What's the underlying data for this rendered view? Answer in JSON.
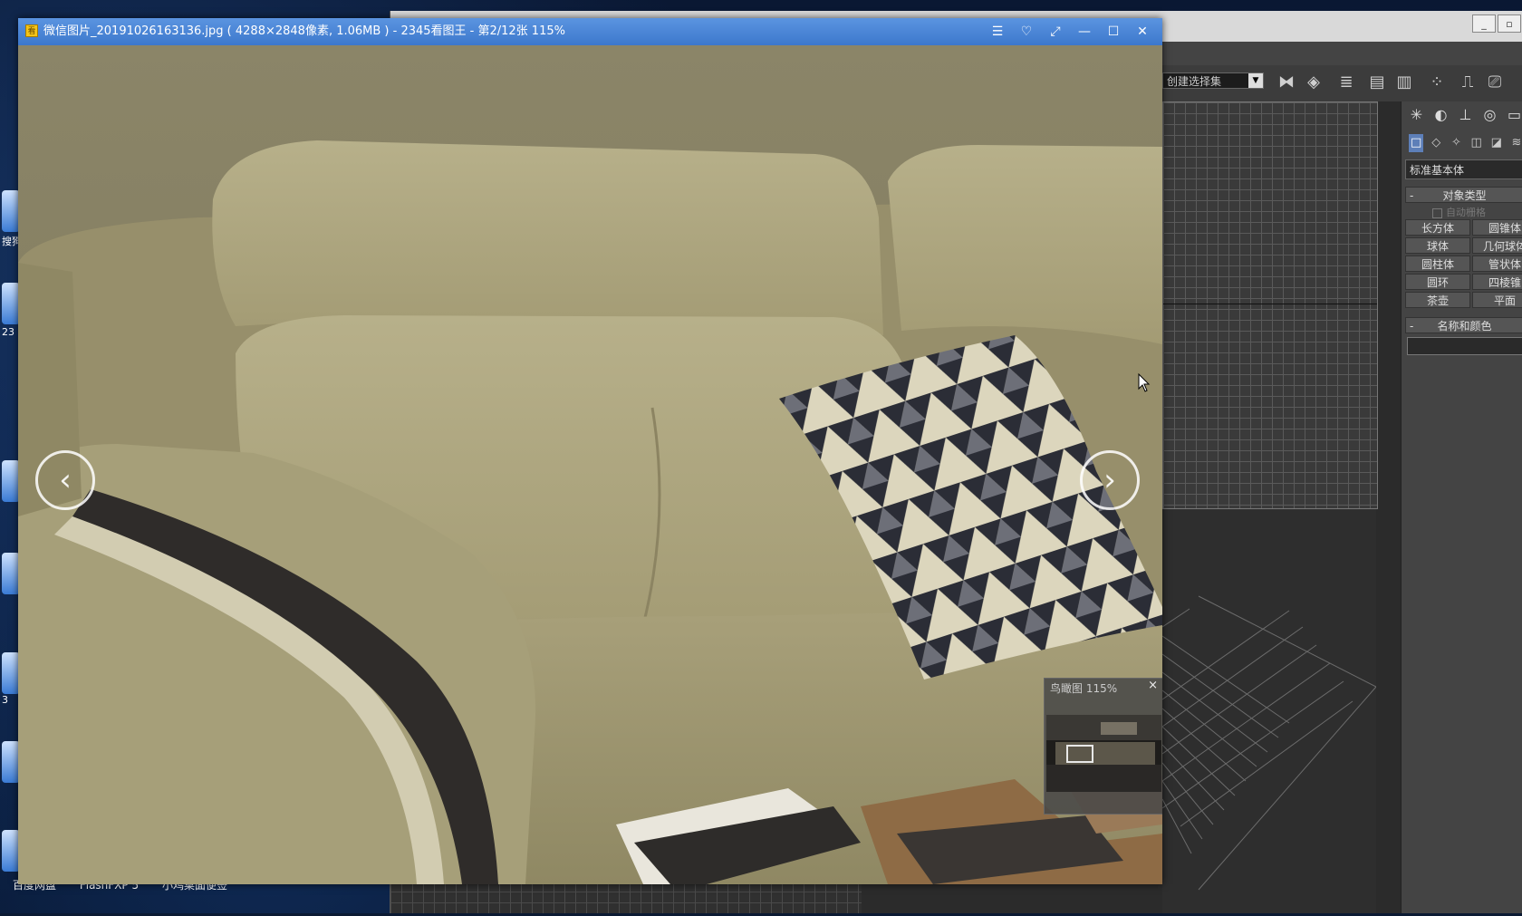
{
  "desktop": {
    "labels": [
      "搜狗",
      "23",
      "3",
      "百度网盘",
      "FlashFXP 5",
      "小鸡桌面便签"
    ]
  },
  "max_app": {
    "named_selection_placeholder": "创建选择集",
    "command_panel": {
      "category": "标准基本体",
      "object_type_title": "对象类型",
      "autogrid_label": "自动栅格",
      "buttons": [
        "长方体",
        "圆锥体",
        "球体",
        "几何球体",
        "圆柱体",
        "管状体",
        "圆环",
        "四棱锥",
        "茶壶",
        "平面"
      ],
      "name_color_title": "名称和颜色",
      "collapse_symbol": "-"
    }
  },
  "viewer": {
    "title": "微信图片_20191026163136.jpg ( 4288×2848像素, 1.06MB ) - 2345看图王 - 第2/12张 115%",
    "controls": {
      "menu": "☰",
      "skin": "♡",
      "fullscreen": "⤢",
      "minimize": "—",
      "maximize": "☐",
      "close": "✕"
    },
    "prev_symbol": "‹",
    "next_symbol": "›",
    "navigator": {
      "title": "鸟瞰图 115%",
      "close": "×"
    }
  },
  "colors": {
    "viewer_title_bg": "#4a86d8",
    "sofa": "#a9a27c",
    "pillow_dark": "#2b2d36",
    "pillow_light": "#dcd6bd"
  }
}
